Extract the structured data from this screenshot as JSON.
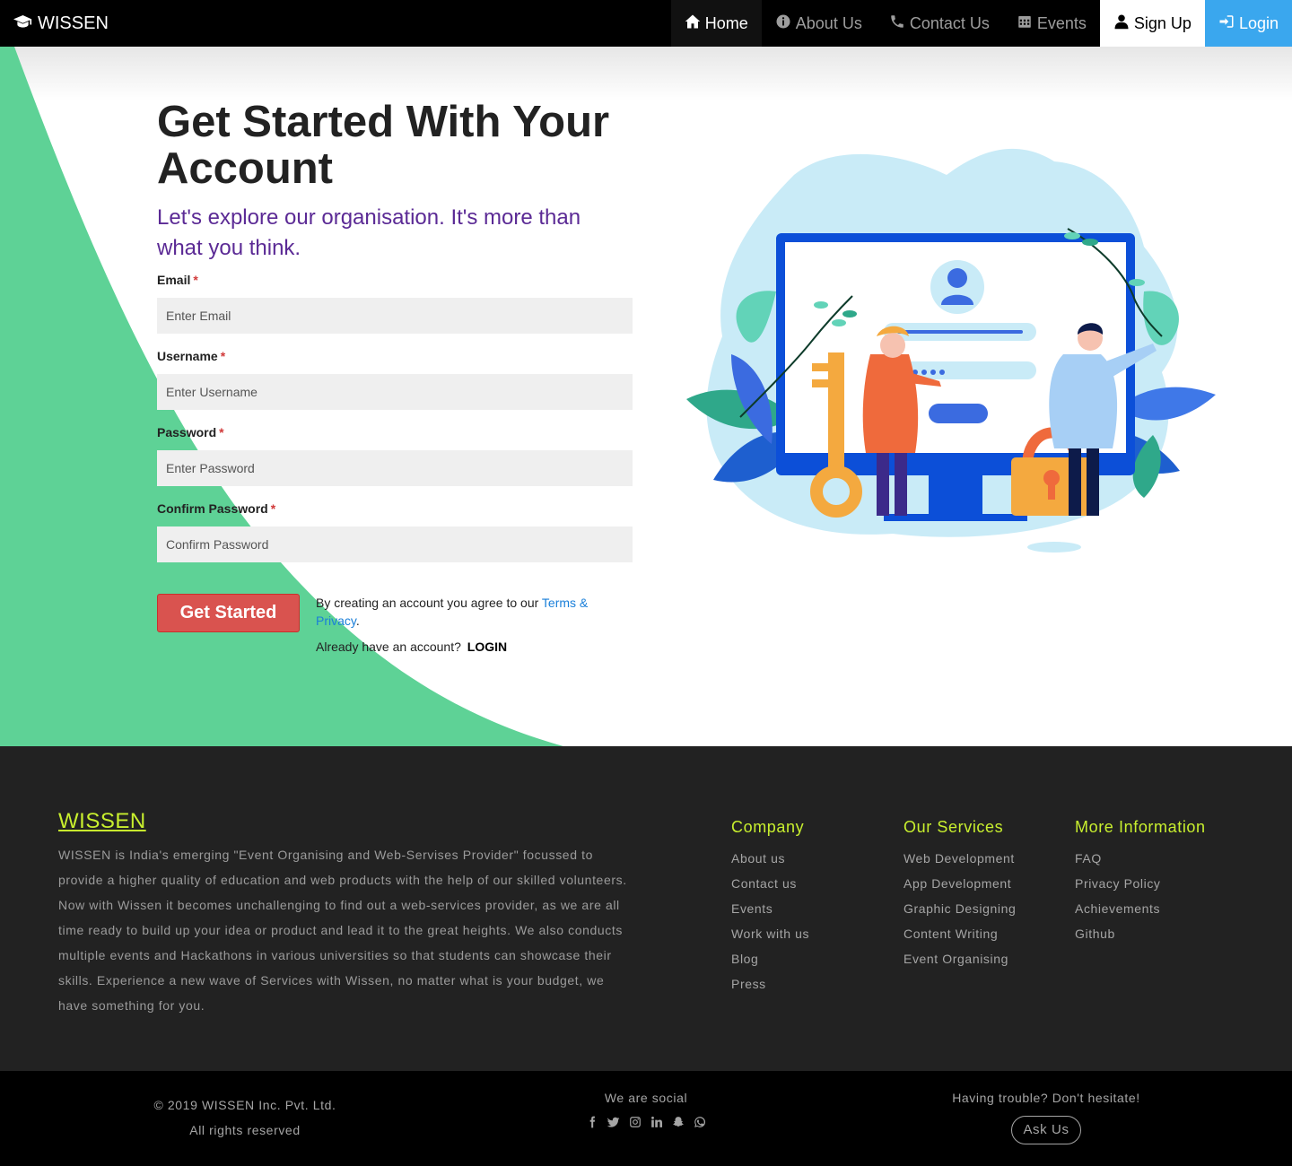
{
  "navbar": {
    "brand": "WISSEN",
    "items": [
      {
        "label": "Home"
      },
      {
        "label": "About Us"
      },
      {
        "label": "Contact Us"
      },
      {
        "label": "Events"
      },
      {
        "label": "Sign Up"
      },
      {
        "label": "Login"
      }
    ]
  },
  "hero": {
    "title": "Get Started With Your Account",
    "subtitle": "Let's explore our organisation. It's more than what you think.",
    "fields": [
      {
        "label": "Email",
        "required_mark": "*",
        "placeholder": "Enter Email"
      },
      {
        "label": "Username",
        "required_mark": "*",
        "placeholder": "Enter Username"
      },
      {
        "label": "Password",
        "required_mark": "*",
        "placeholder": "Enter Password"
      },
      {
        "label": "Confirm Password",
        "required_mark": "*",
        "placeholder": "Confirm Password"
      }
    ],
    "submit_label": "Get Started",
    "terms_prefix": "By creating an account you agree to our",
    "terms_link": "Terms & Privacy",
    "terms_suffix": ".",
    "already_text": "Already have an account?",
    "login_link": "LOGIN"
  },
  "footer": {
    "brand": "WISSEN",
    "description": "WISSEN is India's emerging \"Event Organising and Web-Servises Provider\" focussed to provide a higher quality of education and web products with the help of our skilled volunteers. Now with Wissen it becomes unchallenging to find out a web-services provider, as we are all time ready to build up your idea or product and lead it to the great heights. We also conducts multiple events and Hackathons in various universities so that students can showcase their skills. Experience a new wave of Services with Wissen, no matter what is your budget, we have something for you.",
    "columns": [
      {
        "title": "Company",
        "links": [
          "About us",
          "Contact us",
          "Events",
          "Work with us",
          "Blog",
          "Press"
        ]
      },
      {
        "title": "Our Services",
        "links": [
          "Web Development",
          "App Development",
          "Graphic Designing",
          "Content Writing",
          "Event Organising"
        ]
      },
      {
        "title": "More Information",
        "links": [
          "FAQ",
          "Privacy Policy",
          "Achievements",
          "Github"
        ]
      }
    ]
  },
  "bottom": {
    "copyright_line1": "© 2019 WISSEN Inc. Pvt. Ltd.",
    "copyright_line2": "All rights reserved",
    "social_title": "We are social",
    "social_icons": [
      "facebook-icon",
      "twitter-icon",
      "instagram-icon",
      "linkedin-icon",
      "snapchat-icon",
      "whatsapp-icon"
    ],
    "trouble_text": "Having trouble? Don't hesitate!",
    "ask_label": "Ask Us"
  },
  "colors": {
    "accent_green": "#5ed296",
    "login_blue": "#3aa7ee",
    "button_red": "#d9534f",
    "subtitle_purple": "#5b2a95",
    "footer_accent": "#c8ef2e"
  }
}
